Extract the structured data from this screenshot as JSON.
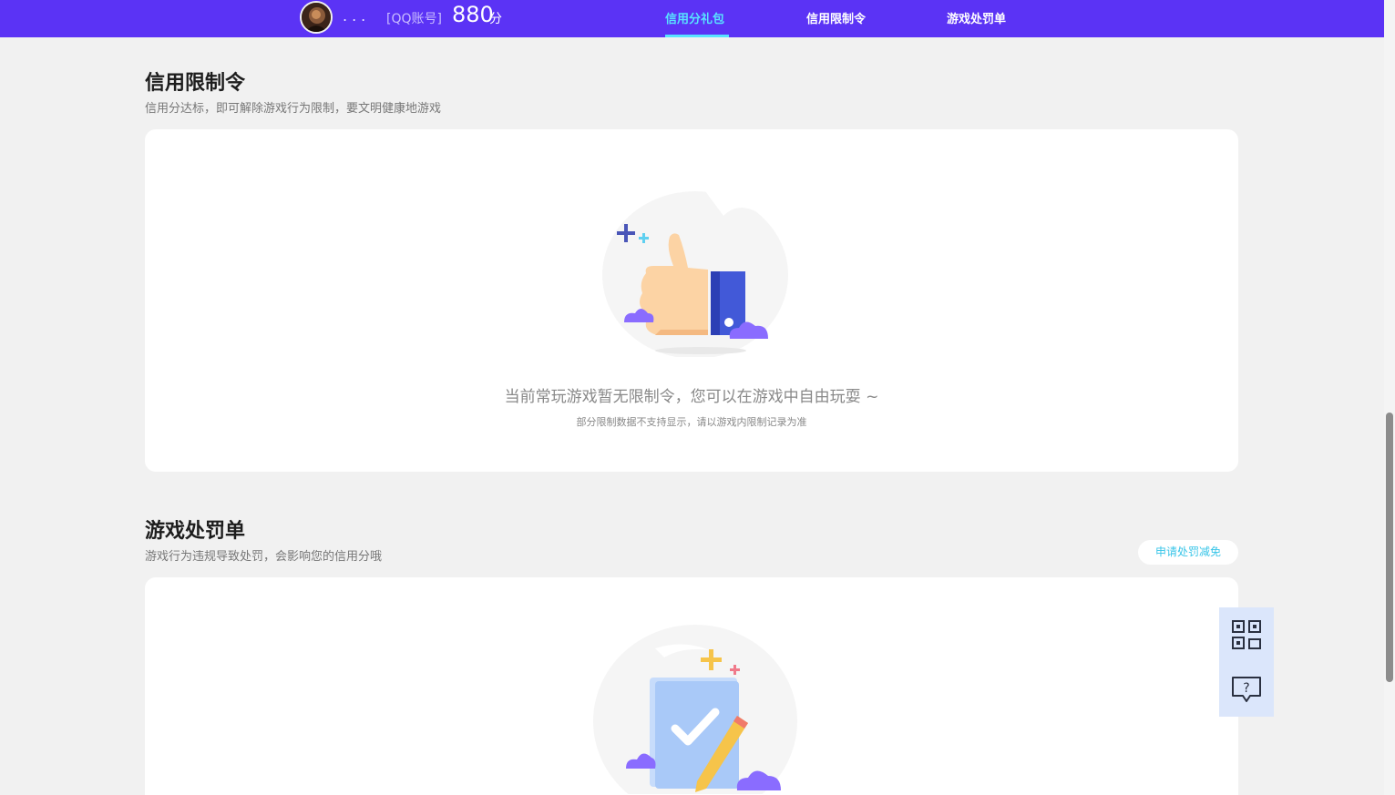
{
  "header": {
    "username": "...",
    "account_type": "[QQ账号]",
    "score": "880",
    "score_unit": "分",
    "tabs": [
      {
        "label": "信用分礼包",
        "active": true
      },
      {
        "label": "信用限制令",
        "active": false
      },
      {
        "label": "游戏处罚单",
        "active": false
      }
    ]
  },
  "restriction": {
    "title": "信用限制令",
    "subtitle": "信用分达标，即可解除游戏行为限制，要文明健康地游戏",
    "empty_main": "当前常玩游戏暂无限制令，您可以在游戏中自由玩耍 ~",
    "empty_sub": "部分限制数据不支持显示，请以游戏内限制记录为准"
  },
  "penalty": {
    "title": "游戏处罚单",
    "subtitle": "游戏行为违规导致处罚，会影响您的信用分哦",
    "apply_button": "申请处罚减免"
  },
  "colors": {
    "header_bg": "#5b33f5",
    "accent": "#58e3ff",
    "apply_text": "#38c5e8",
    "float_bg": "#dbe6fb"
  }
}
